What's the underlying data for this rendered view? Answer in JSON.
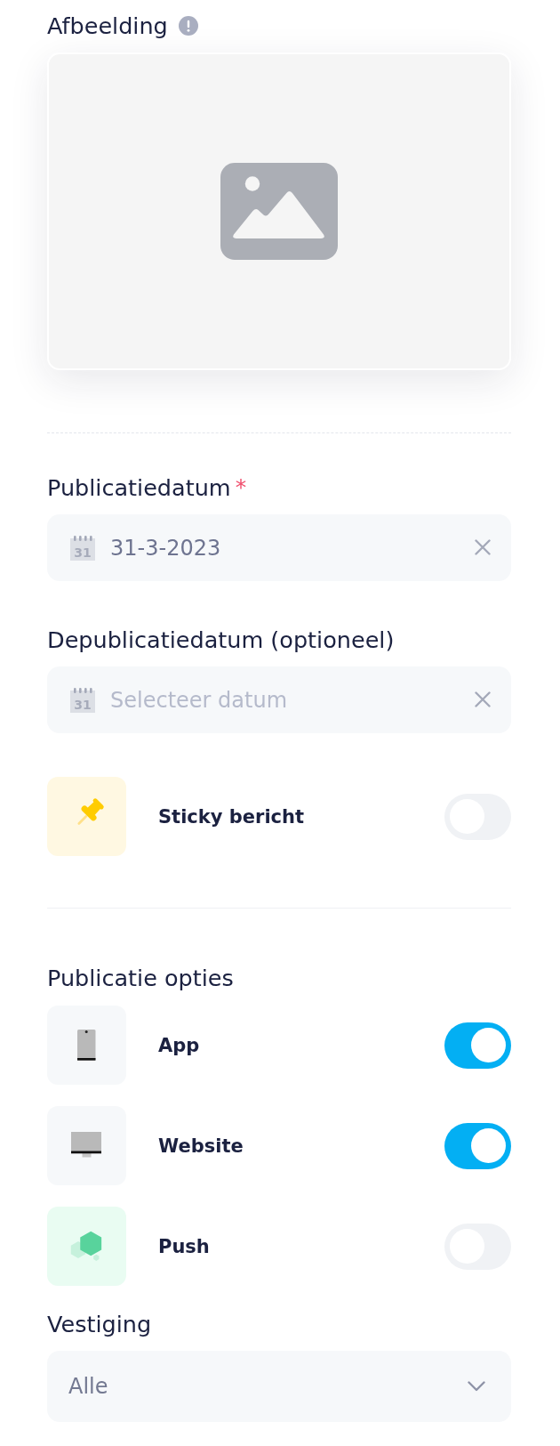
{
  "image_field": {
    "label": "Afbeelding"
  },
  "date_fields": [
    {
      "label": "Publicatiedatum",
      "required_mark": "*",
      "icon_text": "31",
      "value": "31-3-2023"
    },
    {
      "label": "Depublicatiedatum (optioneel)",
      "icon_text": "31",
      "placeholder": "Selecteer datum"
    }
  ],
  "sticky": {
    "kind": "pin",
    "label": "Sticky bericht",
    "on": false
  },
  "publication_options": {
    "title": "Publicatie opties",
    "items": [
      {
        "kind": "app",
        "label": "App",
        "on": true
      },
      {
        "kind": "website",
        "label": "Website",
        "on": true
      },
      {
        "kind": "push",
        "label": "Push",
        "on": false
      }
    ]
  },
  "location": {
    "label": "Vestiging",
    "value": "Alle"
  }
}
